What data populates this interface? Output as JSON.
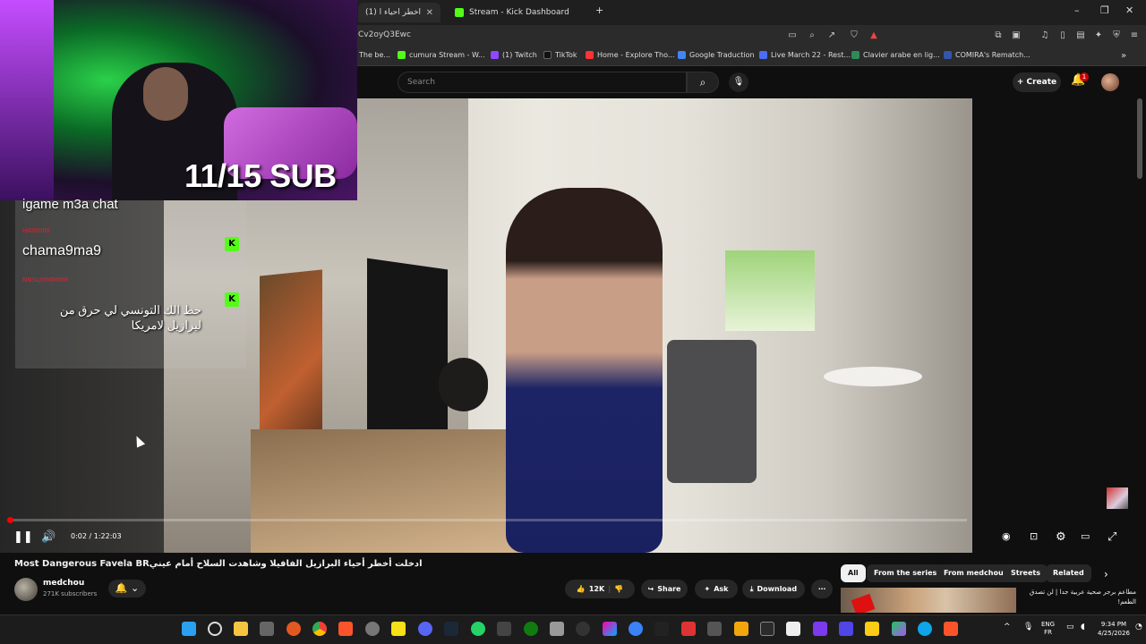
{
  "browser": {
    "tabs": [
      {
        "label": "دخلت أخطر أحياء ا (1)",
        "active": true
      },
      {
        "label": "Stream - Kick Dashboard",
        "active": false
      }
    ],
    "new_tab": "+",
    "url": "Cv2oyQ3Ewc",
    "bookmarks": [
      {
        "label": "The be...",
        "color": "#cc3333"
      },
      {
        "label": "cumura Stream - W...",
        "color": "#53fc18"
      },
      {
        "label": "(1) Twitch",
        "color": "#9146ff"
      },
      {
        "label": "TikTok",
        "color": "#111111"
      },
      {
        "label": "Home - Explore Tho...",
        "color": "#ff3333"
      },
      {
        "label": "Google Traduction",
        "color": "#4285f4"
      },
      {
        "label": "Live March 22 - Rest...",
        "color": "#4a6cf7"
      },
      {
        "label": "Clavier arabe en lig...",
        "color": "#2e8b57"
      },
      {
        "label": "COMIRA's Rematch...",
        "color": "#3355aa"
      }
    ]
  },
  "youtube": {
    "search_placeholder": "Search",
    "create_label": "Create",
    "notification_count": "1"
  },
  "stream_overlay": {
    "sub_goal": "11/15 SUB",
    "chat": [
      {
        "user": "",
        "text": "igame m3a chat"
      },
      {
        "user": "HAIIIIIIIIII",
        "text": "chama9ma9"
      },
      {
        "user": "NNSLJMMMMM",
        "text": "حط الك التونسي لي حرق من ليرازيل لامريكا"
      }
    ],
    "kick_badge": "K"
  },
  "player": {
    "time": "0:02 / 1:22:03",
    "progress": 0.0004
  },
  "video": {
    "title": "Most Dangerous Favela BRادخلت أخطر أحياء البرازيل الفافيلا وشاهدت السلاح أمام عيني",
    "channel": "medchou",
    "subscribers": "271K subscribers",
    "likes": "12K",
    "share_label": "Share",
    "ask_label": "Ask",
    "download_label": "Download"
  },
  "filters": {
    "chips": [
      "All",
      "From the series",
      "From medchou",
      "Streets",
      "Related"
    ],
    "active": "All"
  },
  "recommendation": {
    "title": "مطاعم برجر صحية عربية جدا | لن تصدق الطعم!"
  },
  "taskbar": {
    "lang": "ENG",
    "locale": "FR",
    "time": "9:34 PM",
    "date": "4/25/2026"
  }
}
